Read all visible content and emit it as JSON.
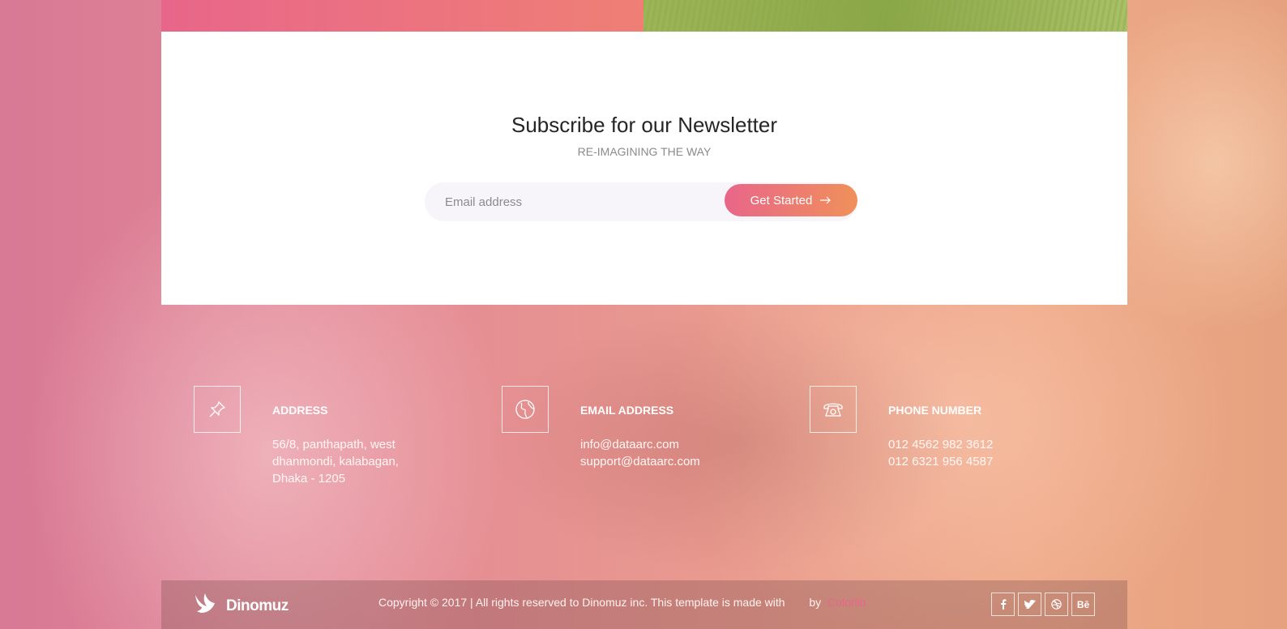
{
  "newsletter": {
    "title": "Subscribe for our Newsletter",
    "subtitle": "RE-IMAGINING THE WAY",
    "email_placeholder": "Email address",
    "button_label": "Get Started"
  },
  "contacts": [
    {
      "icon": "pin-icon",
      "title": "ADDRESS",
      "lines": [
        "56/8, panthapath, west",
        "dhanmondi, kalabagan,",
        "Dhaka - 1205"
      ]
    },
    {
      "icon": "globe-icon",
      "title": "EMAIL ADDRESS",
      "lines": [
        "info@dataarc.com",
        "support@dataarc.com"
      ]
    },
    {
      "icon": "phone-icon",
      "title": "PHONE NUMBER",
      "lines": [
        "012 4562 982 3612",
        "012 6321 956 4587"
      ]
    }
  ],
  "footer": {
    "logo_text": "Dinomuz",
    "copyright": "Copyright © 2017 | All rights reserved to Dinomuz inc. This template is made with",
    "by": "by",
    "brand": "Colorlib",
    "socials": [
      {
        "icon": "facebook-icon",
        "label": "f"
      },
      {
        "icon": "twitter-icon",
        "label": "t"
      },
      {
        "icon": "dribbble-icon",
        "label": "d"
      },
      {
        "icon": "behance-icon",
        "label": "Bē"
      }
    ]
  }
}
